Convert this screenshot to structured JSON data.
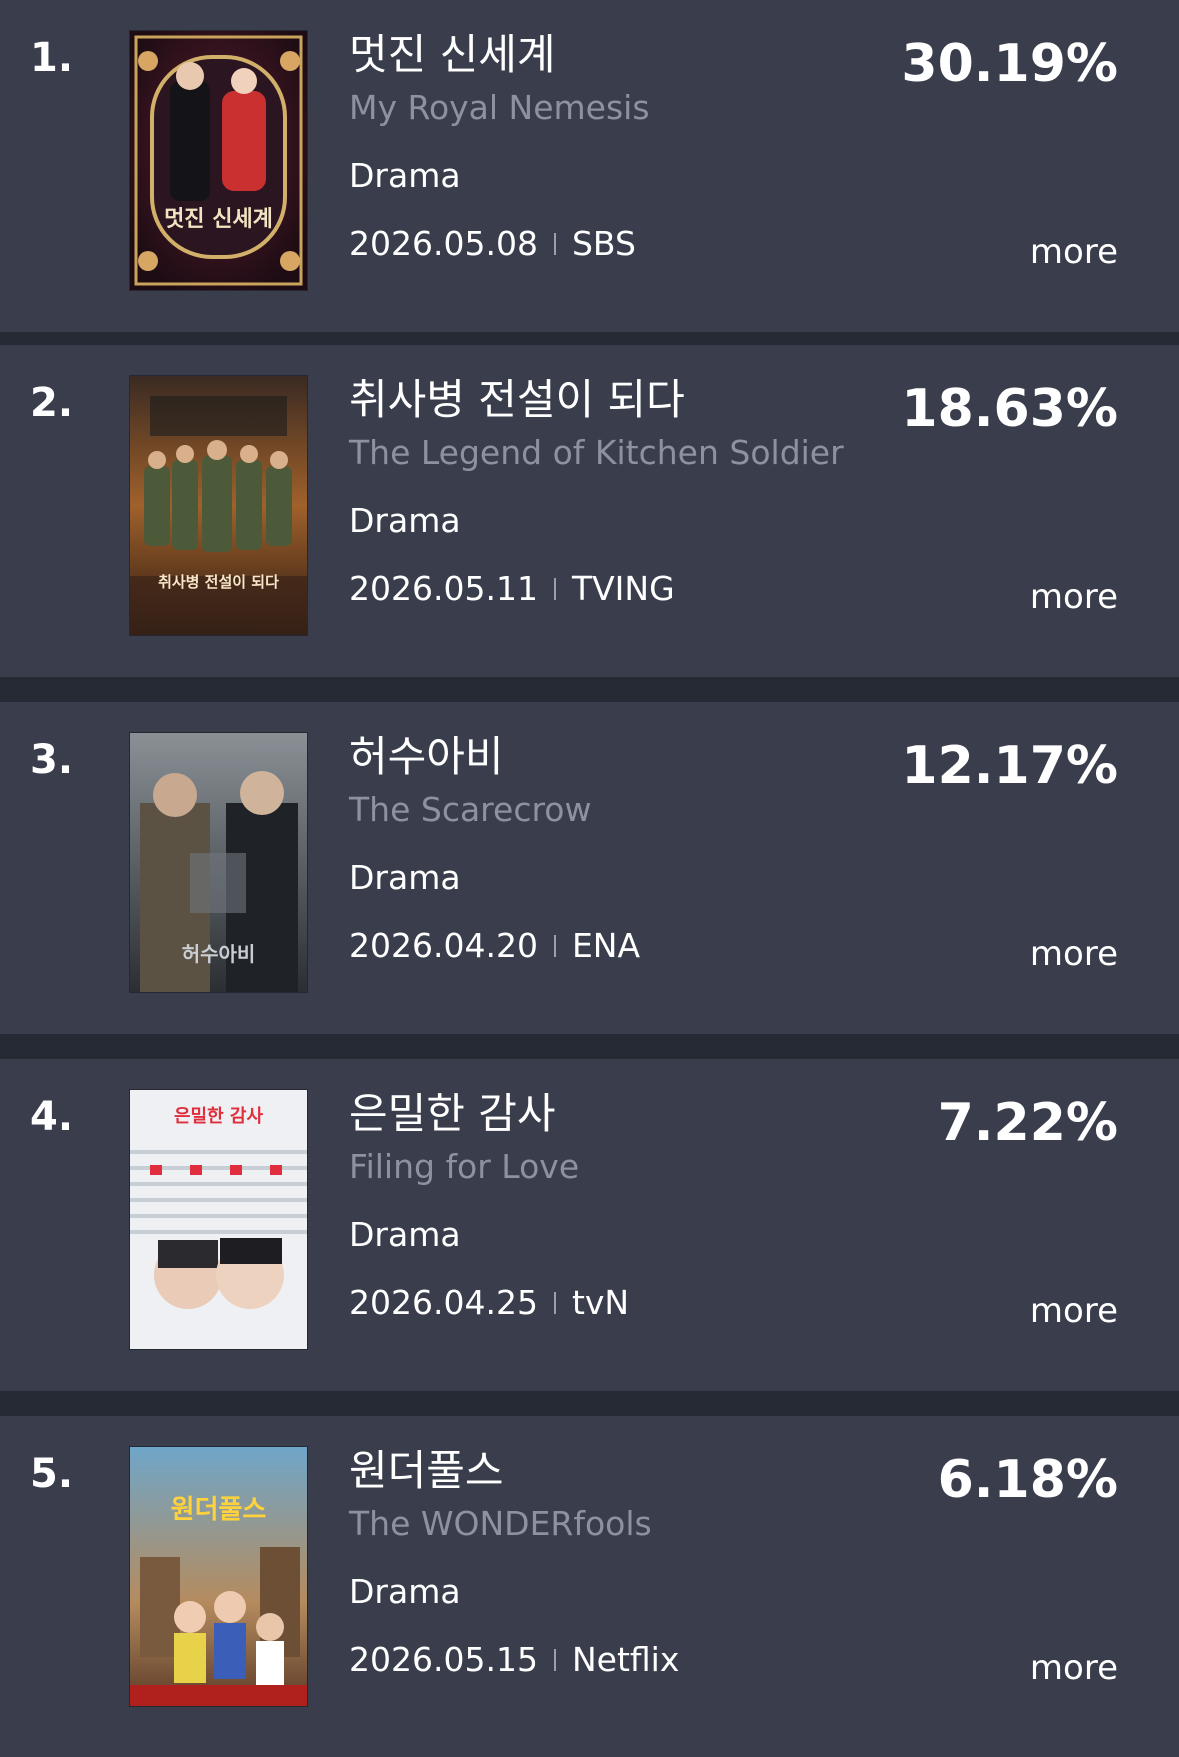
{
  "rankings": [
    {
      "rank": "1.",
      "title_ko": "멋진 신세계",
      "title_en": "My Royal Nemesis",
      "genre": "Drama",
      "date": "2026.05.08",
      "network": "SBS",
      "rating": "30.19%",
      "more_label": "more",
      "poster_title": "멋진 신세계"
    },
    {
      "rank": "2.",
      "title_ko": "취사병 전설이 되다",
      "title_en": "The Legend of Kitchen Soldier",
      "genre": "Drama",
      "date": "2026.05.11",
      "network": "TVING",
      "rating": "18.63%",
      "more_label": "more",
      "poster_title": "취사병 전설이 되다"
    },
    {
      "rank": "3.",
      "title_ko": "허수아비",
      "title_en": "The Scarecrow",
      "genre": "Drama",
      "date": "2026.04.20",
      "network": "ENA",
      "rating": "12.17%",
      "more_label": "more",
      "poster_title": "허수아비"
    },
    {
      "rank": "4.",
      "title_ko": "은밀한 감사",
      "title_en": "Filing for Love",
      "genre": "Drama",
      "date": "2026.04.25",
      "network": "tvN",
      "rating": "7.22%",
      "more_label": "more",
      "poster_title": "은밀한 감사"
    },
    {
      "rank": "5.",
      "title_ko": "원더풀스",
      "title_en": "The WONDERfools",
      "genre": "Drama",
      "date": "2026.05.15",
      "network": "Netflix",
      "rating": "6.18%",
      "more_label": "more",
      "poster_title": "원더풀스"
    }
  ],
  "colors": {
    "background": "#262a35",
    "card": "#3a3e4c",
    "subtitle": "#8e92a0"
  }
}
